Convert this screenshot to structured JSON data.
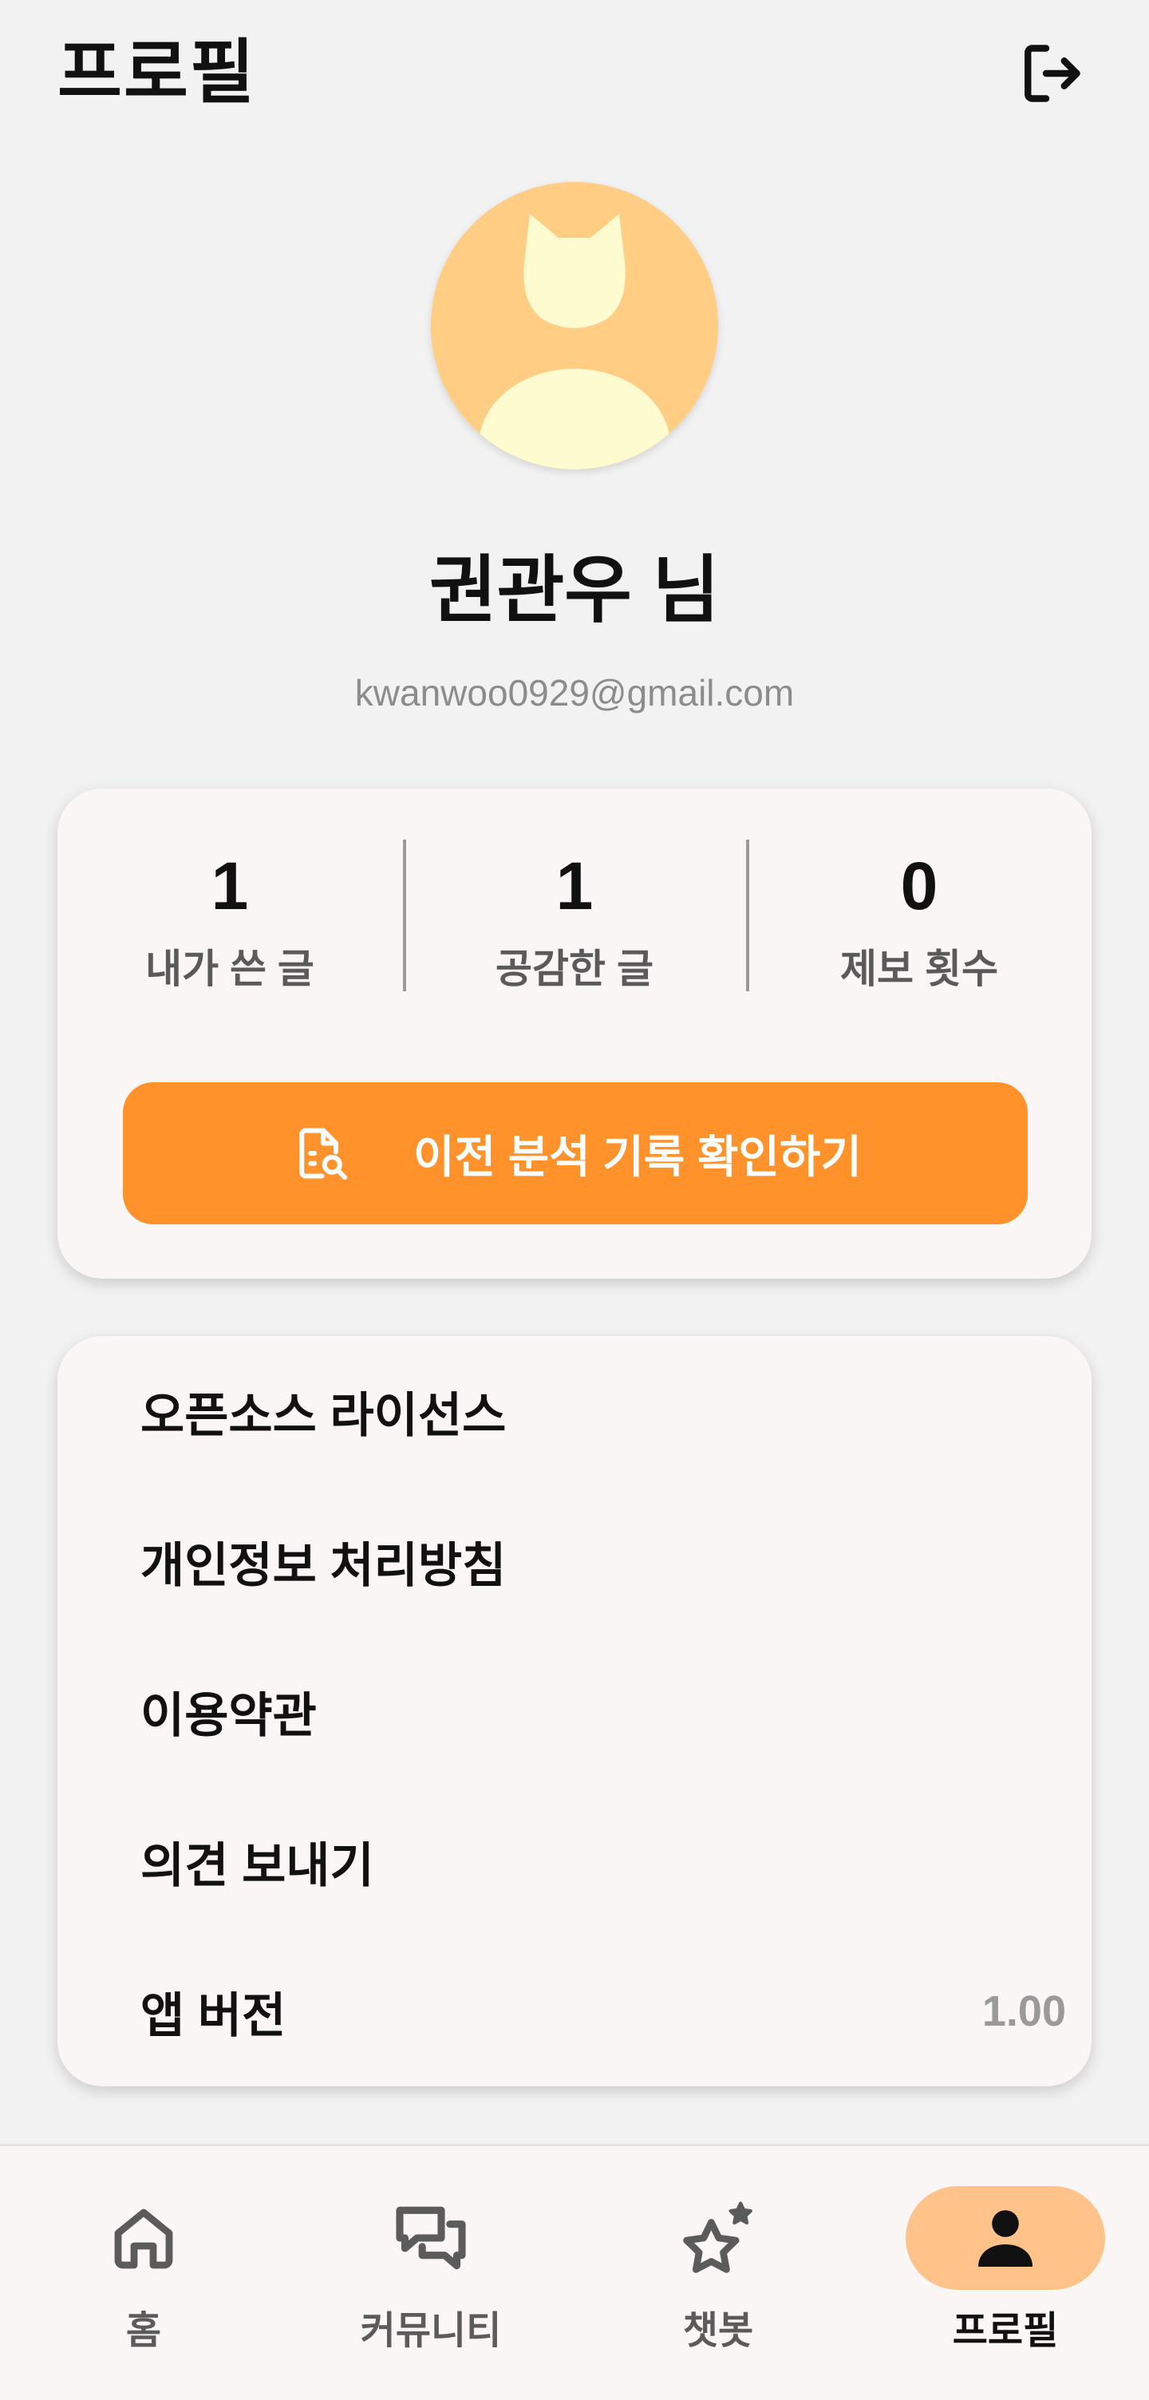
{
  "header": {
    "title": "프로필",
    "logout_icon": "logout-icon"
  },
  "profile": {
    "avatar_icon": "cat-avatar-icon",
    "name": "권관우 님",
    "email": "kwanwoo0929@gmail.com"
  },
  "stats": [
    {
      "value": "1",
      "label": "내가 쓴 글"
    },
    {
      "value": "1",
      "label": "공감한 글"
    },
    {
      "value": "0",
      "label": "제보 횟수"
    }
  ],
  "history_button": {
    "label": "이전 분석 기록 확인하기",
    "icon": "document-search-icon"
  },
  "menu": {
    "items": [
      {
        "label": "오픈소스 라이선스"
      },
      {
        "label": "개인정보 처리방침"
      },
      {
        "label": "이용약관"
      },
      {
        "label": "의견 보내기"
      },
      {
        "label": "앱 버전",
        "value": "1.00"
      }
    ]
  },
  "bottom_nav": {
    "items": [
      {
        "label": "홈",
        "icon": "home-icon",
        "active": false
      },
      {
        "label": "커뮤니티",
        "icon": "chat-bubbles-icon",
        "active": false
      },
      {
        "label": "챗봇",
        "icon": "star-sparkle-icon",
        "active": false
      },
      {
        "label": "프로필",
        "icon": "person-icon",
        "active": true
      }
    ]
  },
  "colors": {
    "accent": "#ff922b",
    "avatar_bg": "#ffcd83",
    "active_tab_bg": "#ffc38a",
    "muted_text": "#8c8c8c"
  }
}
